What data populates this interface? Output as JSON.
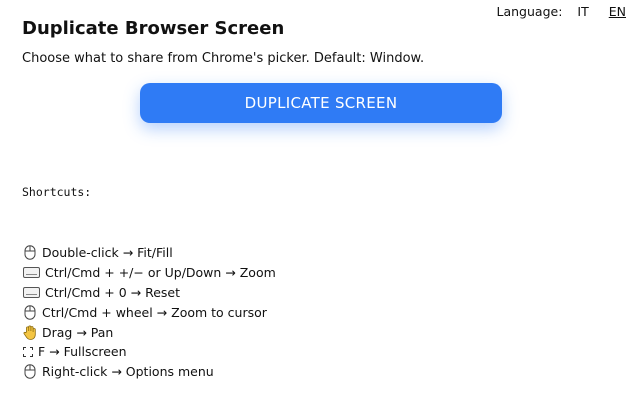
{
  "header": {
    "title": "Duplicate Browser Screen",
    "subtitle": "Choose what to share from Chrome's picker. Default: Window."
  },
  "language": {
    "label": "Language:",
    "options": [
      {
        "code": "IT",
        "active": false
      },
      {
        "code": "EN",
        "active": true
      }
    ]
  },
  "main": {
    "duplicate_button_label": "DUPLICATE SCREEN",
    "button_color": "#2f7bf5"
  },
  "shortcuts": {
    "heading": "Shortcuts:",
    "items": [
      {
        "icon": "mouse-icon",
        "text": "Double-click → Fit/Fill"
      },
      {
        "icon": "keyboard-icon",
        "text": "Ctrl/Cmd + +/− or Up/Down → Zoom"
      },
      {
        "icon": "keyboard-icon",
        "text": "Ctrl/Cmd + 0 → Reset"
      },
      {
        "icon": "mouse-icon",
        "text": "Ctrl/Cmd + wheel → Zoom to cursor"
      },
      {
        "icon": "hand-icon",
        "text": "Drag → Pan"
      },
      {
        "icon": "fullscreen-icon",
        "text": "F → Fullscreen"
      },
      {
        "icon": "mouse-icon",
        "text": "Right-click → Options menu"
      }
    ]
  }
}
